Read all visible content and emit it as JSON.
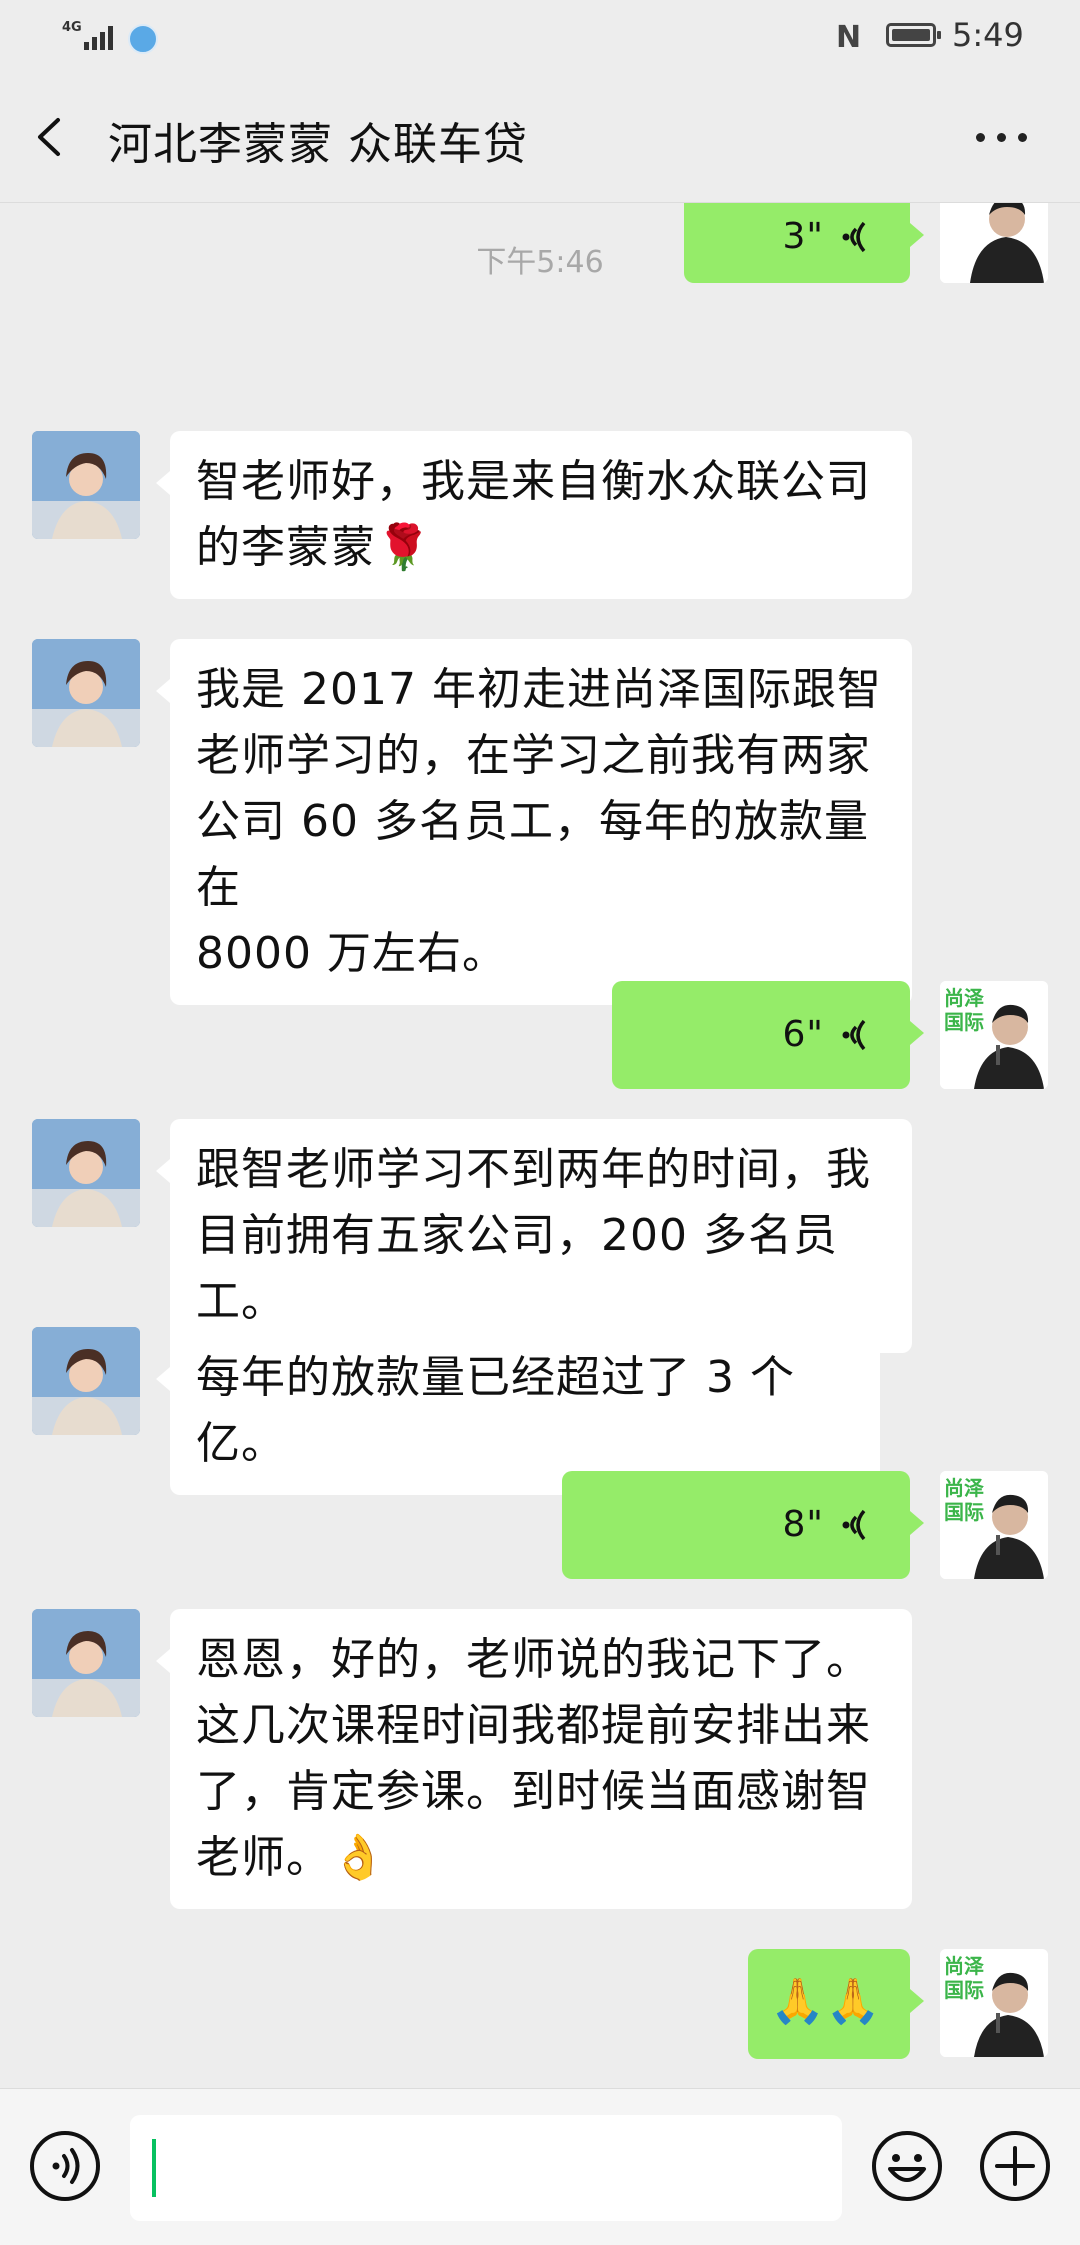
{
  "status_bar": {
    "network": "4G",
    "time": "5:49"
  },
  "header": {
    "title": "河北李蒙蒙 众联车贷"
  },
  "chat": {
    "timestamp": "下午5:46",
    "voice_messages": [
      {
        "duration": "3\""
      },
      {
        "duration": "6\""
      },
      {
        "duration": "8\""
      }
    ],
    "incoming": [
      {
        "lines": [
          "智老师好，我是来自衡水众联公司",
          "的李蒙蒙🌹"
        ]
      },
      {
        "lines": [
          "我是 2017 年初走进尚泽国际跟智",
          "老师学习的，在学习之前我有两家",
          "公司 60 多名员工，每年的放款量在",
          "8000 万左右。"
        ]
      },
      {
        "lines": [
          "跟智老师学习不到两年的时间，我",
          "目前拥有五家公司，200 多名员工。"
        ]
      },
      {
        "lines": [
          "每年的放款量已经超过了 3 个亿。"
        ]
      },
      {
        "lines": [
          "恩恩，好的，老师说的我记下了。",
          "这几次课程时间我都提前安排出来",
          "了，肯定参课。到时候当面感谢智",
          "老师。👌"
        ]
      }
    ],
    "outgoing_emoji": "🙏🙏",
    "self_avatar_text": [
      "尚泽",
      "国际"
    ]
  },
  "input": {
    "value": "",
    "placeholder": ""
  },
  "icons": {
    "back": "back-arrow-icon",
    "more": "more-dots-icon",
    "voice": "voice-wave-icon",
    "emoji": "emoji-icon",
    "plus": "plus-icon"
  }
}
